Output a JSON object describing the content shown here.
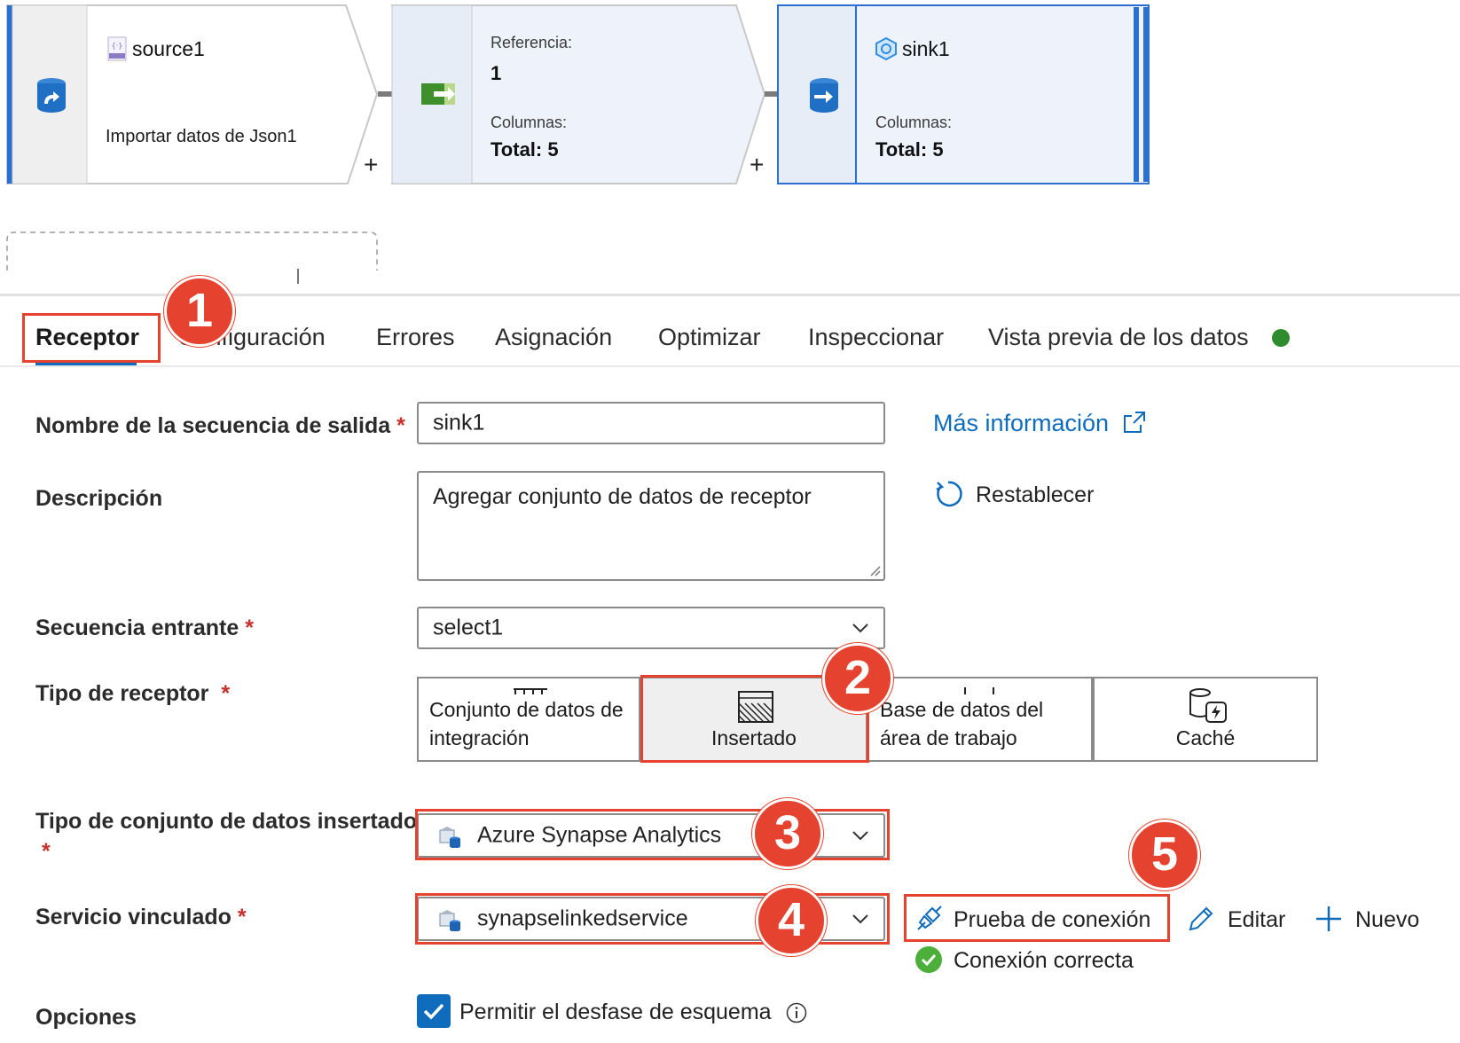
{
  "pipeline": {
    "source": {
      "title": "source1",
      "description": "Importar datos de Json1",
      "icon": "json-file-icon",
      "plus": "+"
    },
    "select": {
      "ref_label": "Referencia:",
      "ref_value": "1",
      "columns_label": "Columnas:",
      "columns_total": "Total: 5",
      "plus": "+"
    },
    "sink": {
      "title": "sink1",
      "columns_label": "Columnas:",
      "columns_total": "Total: 5"
    }
  },
  "tabs": [
    {
      "label": "Receptor",
      "active": true
    },
    {
      "label": "Configuración"
    },
    {
      "label": "Errores"
    },
    {
      "label": "Asignación"
    },
    {
      "label": "Optimizar"
    },
    {
      "label": "Inspeccionar"
    },
    {
      "label": "Vista previa de los datos",
      "status_color": "#2e8b2e"
    }
  ],
  "callouts": [
    "1",
    "2",
    "3",
    "4",
    "5"
  ],
  "form": {
    "output_stream": {
      "label": "Nombre de la secuencia de salida",
      "required": "*",
      "value": "sink1"
    },
    "description": {
      "label": "Descripción",
      "value": "Agregar conjunto de datos de receptor"
    },
    "incoming_stream": {
      "label": "Secuencia entrante",
      "required": "*",
      "value": "select1"
    },
    "sink_type": {
      "label": "Tipo de receptor",
      "required": "*",
      "options": [
        {
          "line1": "Conjunto de datos de",
          "line2": "integración"
        },
        {
          "line1": "Insertado",
          "selected": true
        },
        {
          "line1": "Base de datos del",
          "line2": "área de trabajo"
        },
        {
          "line1": "Caché"
        }
      ]
    },
    "inline_dataset_type": {
      "label": "Tipo de conjunto de datos insertado",
      "required": "*",
      "value": "Azure Synapse Analytics"
    },
    "linked_service": {
      "label": "Servicio vinculado",
      "required": "*",
      "value": "synapselinkedservice"
    },
    "options": {
      "label": "Opciones",
      "checkbox_label": "Permitir el desfase de esquema",
      "checked": true
    }
  },
  "actions": {
    "more_info": "Más información",
    "reset": "Restablecer",
    "test_connection": "Prueba de conexión",
    "edit": "Editar",
    "new": "Nuevo",
    "connection_status": "Conexión correcta"
  },
  "colors": {
    "accent": "#0f6cbd",
    "callout": "#e5432f",
    "success": "#2e8b2e",
    "node_fill": "#eef3fb",
    "sink_border": "#2b6fd1"
  }
}
